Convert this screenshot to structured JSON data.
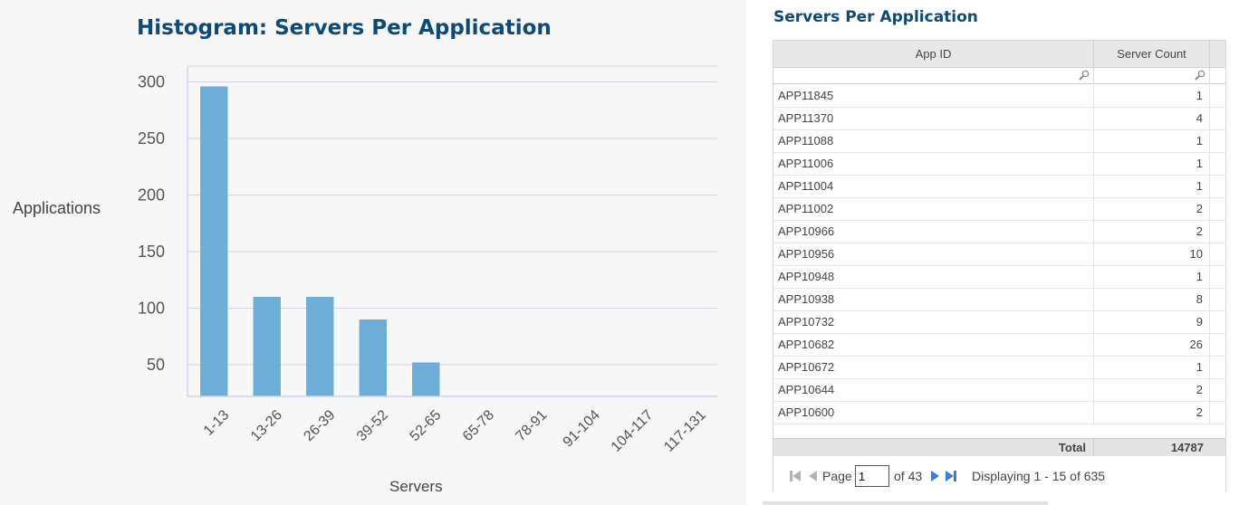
{
  "left": {
    "title": "Histogram: Servers Per Application"
  },
  "chart_data": {
    "type": "bar",
    "title": "Histogram: Servers Per Application",
    "xlabel": "Servers",
    "ylabel": "Applications",
    "categories": [
      "1-13",
      "13-26",
      "26-39",
      "39-52",
      "52-65",
      "65-78",
      "78-91",
      "91-104",
      "104-117",
      "117-131"
    ],
    "values": [
      296,
      110,
      110,
      90,
      52,
      9,
      9,
      4,
      0,
      0
    ],
    "yticks": [
      50,
      100,
      150,
      200,
      250,
      300
    ],
    "ylim": [
      22,
      314
    ],
    "grid": true,
    "bar_color": "#6eaed6"
  },
  "right": {
    "title": "Servers Per Application",
    "columns": [
      "App ID",
      "Server Count"
    ],
    "rows": [
      {
        "app": "APP11845",
        "count": "1"
      },
      {
        "app": "APP11370",
        "count": "4"
      },
      {
        "app": "APP11088",
        "count": "1"
      },
      {
        "app": "APP11006",
        "count": "1"
      },
      {
        "app": "APP11004",
        "count": "1"
      },
      {
        "app": "APP11002",
        "count": "2"
      },
      {
        "app": "APP10966",
        "count": "2"
      },
      {
        "app": "APP10956",
        "count": "10"
      },
      {
        "app": "APP10948",
        "count": "1"
      },
      {
        "app": "APP10938",
        "count": "8"
      },
      {
        "app": "APP10732",
        "count": "9"
      },
      {
        "app": "APP10682",
        "count": "26"
      },
      {
        "app": "APP10672",
        "count": "1"
      },
      {
        "app": "APP10644",
        "count": "2"
      },
      {
        "app": "APP10600",
        "count": "2"
      }
    ],
    "total_label": "Total",
    "total_value": "14787",
    "pager": {
      "page_label": "Page",
      "page_value": "1",
      "of_text": "of 43",
      "display_text": "Displaying 1 - 15 of 635"
    },
    "icons": {
      "filter": "magnifier-icon",
      "first": "first-page-icon",
      "prev": "prev-page-icon",
      "next": "next-page-icon",
      "last": "last-page-icon"
    }
  }
}
